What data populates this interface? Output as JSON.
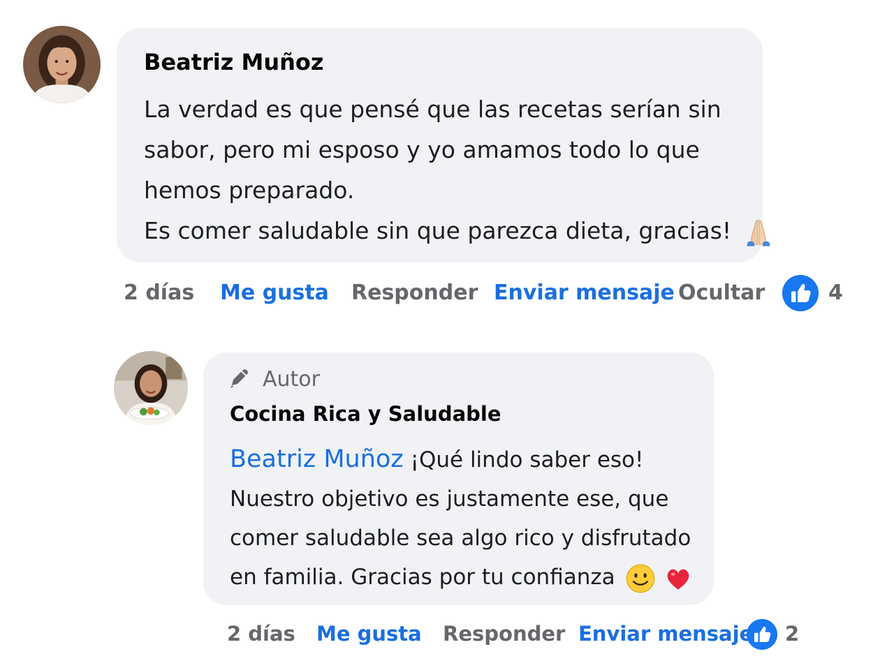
{
  "comment": {
    "author": "Beatriz Muñoz",
    "text_lines": [
      "La verdad es que pensé que las recetas serían sin",
      "sabor, pero mi esposo y yo amamos todo lo que",
      "hemos preparado.",
      "Es comer saludable sin que parezca dieta, gracias!"
    ],
    "emoji_icon": "folded-hands-icon",
    "actions": {
      "time": "2 días",
      "like": "Me gusta",
      "reply": "Responder",
      "message": "Enviar mensaje",
      "hide": "Ocultar"
    },
    "like_count": "4"
  },
  "reply": {
    "badge_label": "Autor",
    "badge_icon": "pencil-icon",
    "author": "Cocina Rica y Saludable",
    "mention": "Beatriz Muñoz",
    "text_first": "¡Qué lindo saber eso!",
    "text_lines": [
      "Nuestro objetivo es justamente ese, que",
      "comer saludable sea algo rico y disfrutado",
      "en familia. Gracias por tu confianza"
    ],
    "emoji_icons": [
      "smiling-face-icon",
      "red-heart-icon"
    ],
    "actions": {
      "time": "2 días",
      "like": "Me gusta",
      "reply": "Responder",
      "message": "Enviar mensaje"
    },
    "like_count": "2"
  },
  "colors": {
    "link_blue": "#1a6fe0",
    "like_blue": "#1877f2",
    "bubble_bg": "#f0f2f5",
    "muted_text": "#65676b"
  }
}
